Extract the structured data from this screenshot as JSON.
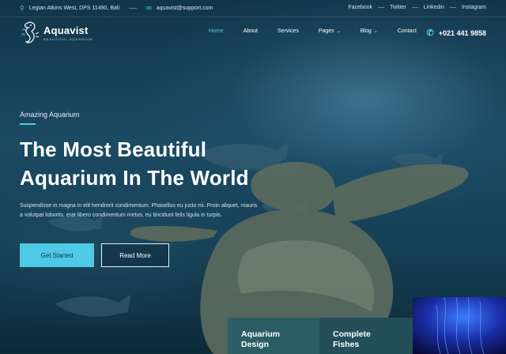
{
  "topbar": {
    "address": "Legian Atkins West, DPS 11490, Bali",
    "email": "aquavist@support.com",
    "socials": [
      "Facebook",
      "Twitter",
      "Linkedin",
      "Instagram"
    ],
    "icons": {
      "address": "map-pin-icon",
      "email": "envelope-icon"
    }
  },
  "logo": {
    "title": "Aquavist",
    "subtitle": "BEAUTIFUL AQUARIUM"
  },
  "nav": {
    "items": [
      {
        "label": "Home",
        "active": true,
        "dropdown": false
      },
      {
        "label": "About",
        "active": false,
        "dropdown": false
      },
      {
        "label": "Services",
        "active": false,
        "dropdown": false
      },
      {
        "label": "Pages",
        "active": false,
        "dropdown": true
      },
      {
        "label": "Blog",
        "active": false,
        "dropdown": true
      },
      {
        "label": "Contact",
        "active": false,
        "dropdown": false
      }
    ],
    "phone": "+021 441 9858",
    "phone_icon": "phone-icon"
  },
  "hero": {
    "eyebrow": "Amazing Aquarium",
    "headline_line1": "The Most Beautiful",
    "headline_line2": "Aquarium In The World",
    "description": "Suspendisse in magna in elit hendrerit condimentum. Phasellus eu justo mi. Proin aliquet, mauris a volutpat lobortis, erat libero condimentum metus, eu tincidunt felis ligula in turpis.",
    "primary_button": "Get Started",
    "secondary_button": "Read More"
  },
  "cards": [
    {
      "title_line1": "Aquarium",
      "title_line2": "Design"
    },
    {
      "title_line1": "Complete",
      "title_line2": "Fishes"
    }
  ],
  "colors": {
    "accent": "#4ec9e6",
    "card1": "#2b5e63",
    "card2": "#244f58"
  }
}
